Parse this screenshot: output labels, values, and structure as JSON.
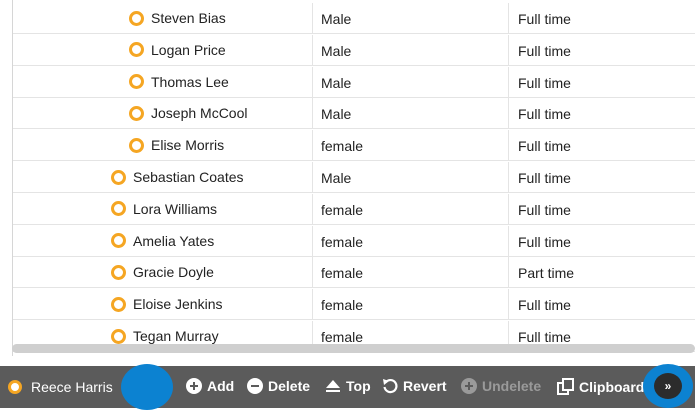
{
  "rows": [
    {
      "name": "Steven Bias",
      "gender": "Male",
      "type": "Full time",
      "level": 2
    },
    {
      "name": "Logan Price",
      "gender": "Male",
      "type": "Full time",
      "level": 2
    },
    {
      "name": "Thomas Lee",
      "gender": "Male",
      "type": "Full time",
      "level": 2
    },
    {
      "name": "Joseph McCool",
      "gender": "Male",
      "type": "Full time",
      "level": 2
    },
    {
      "name": "Elise Morris",
      "gender": "female",
      "type": "Full time",
      "level": 2
    },
    {
      "name": "Sebastian Coates",
      "gender": "Male",
      "type": "Full time",
      "level": 1
    },
    {
      "name": "Lora Williams",
      "gender": "female",
      "type": "Full time",
      "level": 1
    },
    {
      "name": "Amelia Yates",
      "gender": "female",
      "type": "Full time",
      "level": 1
    },
    {
      "name": "Gracie Doyle",
      "gender": "female",
      "type": "Part time",
      "level": 1
    },
    {
      "name": "Eloise Jenkins",
      "gender": "female",
      "type": "Full time",
      "level": 1
    },
    {
      "name": "Tegan Murray",
      "gender": "female",
      "type": "Full time",
      "level": 1
    }
  ],
  "toolbar": {
    "selected_name": "Reece Harris",
    "add_label": "Add",
    "delete_label": "Delete",
    "top_label": "Top",
    "revert_label": "Revert",
    "undelete_label": "Undelete",
    "clipboard_label": "Clipboard",
    "more_label": "»"
  },
  "colors": {
    "node_icon": "#f5a623",
    "toolbar_bg": "#5b5b5b",
    "highlight": "#0c82d1"
  }
}
